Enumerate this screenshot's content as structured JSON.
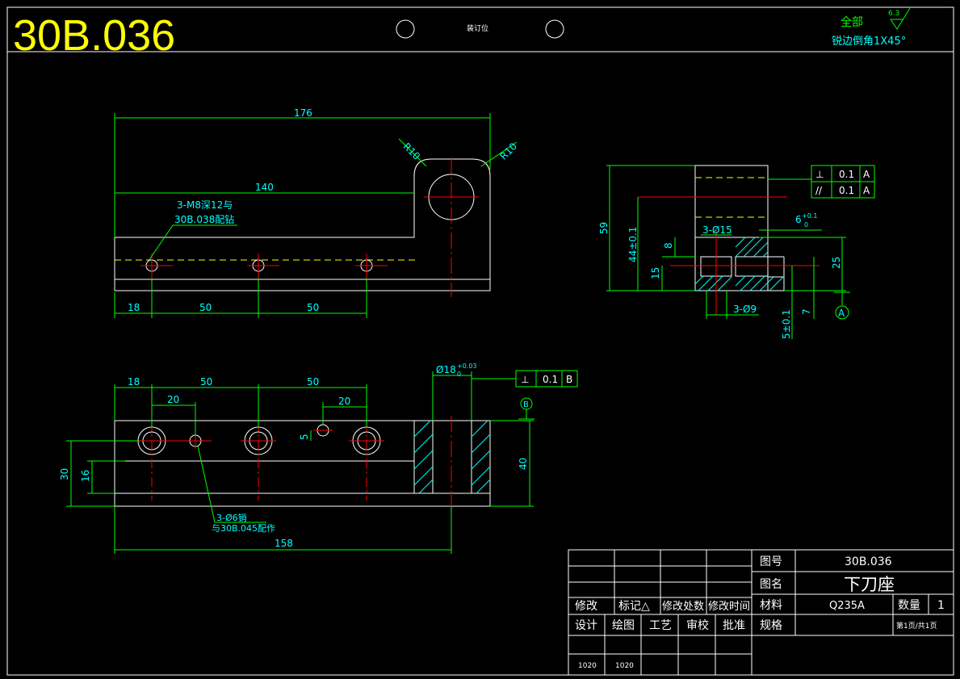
{
  "header": {
    "drawing_code": "30B.036",
    "binding_label": "装订位",
    "surface_note_line1": "全部",
    "surface_roughness": "6.3",
    "surface_note_line2": "锐边倒角1X45°"
  },
  "view_top": {
    "dim_176": "176",
    "dim_140": "140",
    "radius_left": "R10",
    "radius_right": "R10",
    "note_line1": "3-M8深12与",
    "note_line2": "30B.038配钻",
    "dim_18": "18",
    "dim_50a": "50",
    "dim_50b": "50"
  },
  "view_side": {
    "dim_59": "59",
    "dim_44": "44±0.1",
    "dim_8": "8",
    "dim_15": "15",
    "holes_15": "3-Ø15",
    "dim_6": "6",
    "tol_6_upper": "+0.1",
    "tol_6_lower": "0",
    "dim_25": "25",
    "holes_9": "3-Ø9",
    "dim_5": "5±0.1",
    "dim_7": "7",
    "datum_a": "A",
    "gtol1_symbol": "⊥",
    "gtol1_value": "0.1",
    "gtol1_datum": "A",
    "gtol2_symbol": "//",
    "gtol2_value": "0.1",
    "gtol2_datum": "A"
  },
  "view_front": {
    "dim_18": "18",
    "dim_50a": "50",
    "dim_50b": "50",
    "dim_20a": "20",
    "dim_20b": "20",
    "dim_5": "5",
    "bore": "Ø18",
    "bore_tol_upper": "+0.03",
    "bore_tol_lower": "0",
    "gtol_symbol": "⊥",
    "gtol_value": "0.1",
    "gtol_datum": "B",
    "datum_b": "B",
    "dim_30": "30",
    "dim_16": "16",
    "dim_40": "40",
    "dim_158": "158",
    "note_line1": "3-Ø6销",
    "note_line2": "与30B.045配作"
  },
  "title_block": {
    "label_modify": "修改",
    "label_mark": "标记△",
    "label_locations": "修改处数",
    "label_time": "修改时间",
    "label_design": "设计",
    "label_draw": "绘图",
    "label_process": "工艺",
    "label_check": "审校",
    "label_approve": "批准",
    "design_date": "1020",
    "draw_date": "1020",
    "label_drawing_no": "图号",
    "drawing_no": "30B.036",
    "label_drawing_name": "图名",
    "drawing_name": "下刀座",
    "label_material": "材料",
    "material": "Q235A",
    "label_quantity": "数量",
    "quantity": "1",
    "label_spec": "规格",
    "page_info": "第1页/共1页"
  },
  "colors": {
    "background": "#000000",
    "part_outline": "#ffffff",
    "dimension": "#00ff00",
    "dimension_text": "#00ffff",
    "center_line": "#ff0000",
    "hidden_line": "#ffff00",
    "title_text": "#ffff00"
  }
}
